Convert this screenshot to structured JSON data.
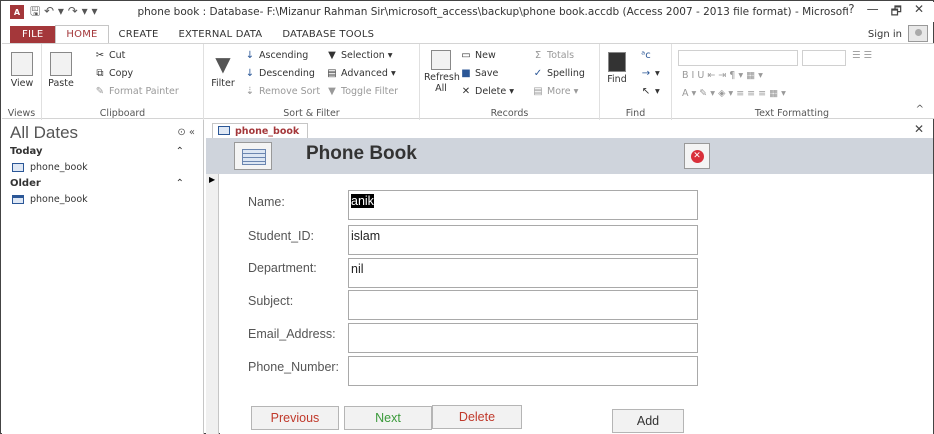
{
  "window": {
    "app_icon": "A",
    "quick_access": "🖫 ↶ ▾ ↷ ▾ ▾",
    "title": "phone book : Database- F:\\Mizanur Rahman Sir\\microsoft_access\\backup\\phone book.accdb (Access 2007 - 2013 file format) - Microsoft...",
    "controls": [
      "?",
      "—",
      "🗗",
      "✕"
    ]
  },
  "ribbon_tabs": [
    "FILE",
    "HOME",
    "CREATE",
    "EXTERNAL DATA",
    "DATABASE TOOLS"
  ],
  "sign_in": "Sign in",
  "ribbon": {
    "views": {
      "view": "View",
      "label": "Views"
    },
    "clipboard": {
      "paste": "Paste",
      "cut": "Cut",
      "copy": "Copy",
      "format_painter": "Format Painter",
      "label": "Clipboard"
    },
    "sort_filter": {
      "filter": "Filter",
      "ascending": "Ascending",
      "descending": "Descending",
      "remove_sort": "Remove Sort",
      "selection": "Selection",
      "advanced": "Advanced",
      "toggle_filter": "Toggle Filter",
      "label": "Sort & Filter"
    },
    "records": {
      "refresh": "Refresh",
      "refresh2": "All",
      "new": "New",
      "save": "Save",
      "delete": "Delete",
      "totals": "Totals",
      "spelling": "Spelling",
      "more": "More",
      "label": "Records"
    },
    "find": {
      "find": "Find",
      "label": "Find"
    },
    "text_formatting": {
      "label": "Text Formatting"
    }
  },
  "nav": {
    "title": "All Dates",
    "sections": [
      {
        "label": "Today",
        "item": "phone_book"
      },
      {
        "label": "Older",
        "item": "phone_book"
      }
    ]
  },
  "document_tab": "phone_book",
  "form": {
    "title": "Phone Book",
    "fields": [
      {
        "label": "Name:",
        "value": "anik"
      },
      {
        "label": "Student_ID:",
        "value": "islam"
      },
      {
        "label": "Department:",
        "value": "nil"
      },
      {
        "label": "Subject:",
        "value": ""
      },
      {
        "label": "Email_Address:",
        "value": ""
      },
      {
        "label": "Phone_Number:",
        "value": ""
      }
    ],
    "buttons": {
      "previous": "Previous",
      "next": "Next",
      "delete": "Delete",
      "add": "Add"
    }
  },
  "colors": {
    "access_red": "#a4373a",
    "previous_text": "#c0392b",
    "next_text": "#3a9a3a",
    "delete_text": "#c0392b",
    "add_text": "#333333"
  }
}
